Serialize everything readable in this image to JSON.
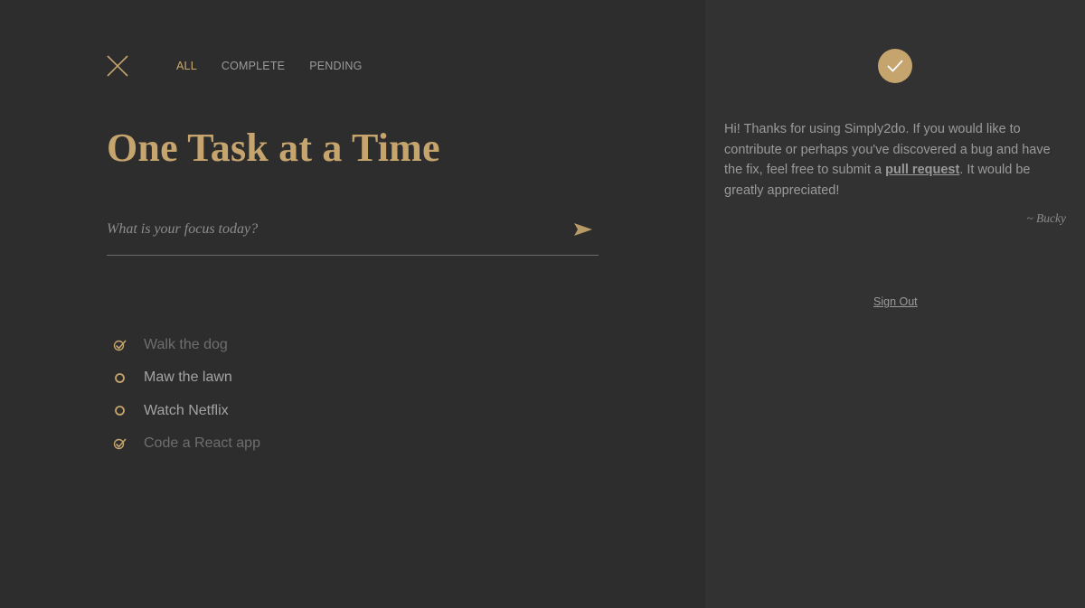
{
  "filters": [
    {
      "label": "ALL",
      "active": true
    },
    {
      "label": "COMPLETE",
      "active": false
    },
    {
      "label": "PENDING",
      "active": false
    }
  ],
  "title": "One Task at a Time",
  "input": {
    "placeholder": "What is your focus today?",
    "value": ""
  },
  "tasks": [
    {
      "text": "Walk the dog",
      "done": true
    },
    {
      "text": "Maw the lawn",
      "done": false
    },
    {
      "text": "Watch Netflix",
      "done": false
    },
    {
      "text": "Code a React app",
      "done": true
    }
  ],
  "sidebar": {
    "message_before": "Hi! Thanks for using Simply2do. If you would like to contribute or perhaps you've discovered a bug and have the fix, feel free to submit a ",
    "link_label": "pull request",
    "message_after": ". It would be greatly appreciated!",
    "signature": "~ Bucky",
    "signout_label": "Sign Out"
  },
  "icons": {
    "close": "close-icon",
    "send": "send-icon",
    "checked": "checkmark-icon",
    "unchecked": "circle-icon",
    "avatar": "check-badge-icon"
  },
  "colors": {
    "accent": "#c5a46d",
    "background": "#2d2d2d",
    "sidebar": "#323232",
    "text": "#9a9a9a"
  }
}
